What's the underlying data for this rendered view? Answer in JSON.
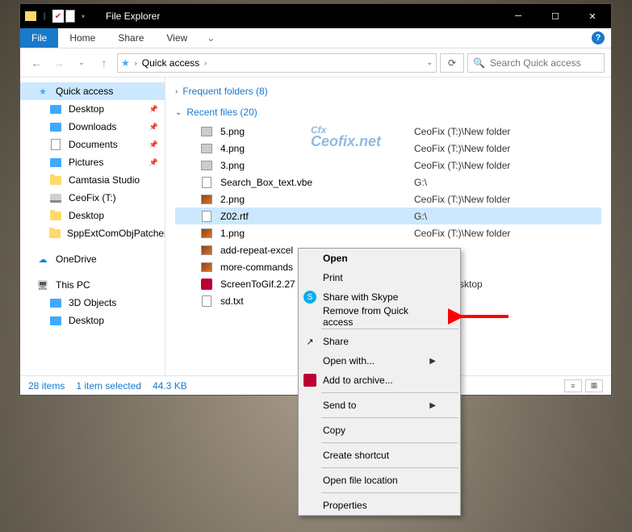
{
  "titlebar": {
    "title": "File Explorer"
  },
  "ribbon": {
    "file": "File",
    "tabs": [
      "Home",
      "Share",
      "View"
    ]
  },
  "address": {
    "location": "Quick access",
    "search_placeholder": "Search Quick access"
  },
  "sidebar": {
    "quick_access": "Quick access",
    "items": [
      {
        "label": "Desktop",
        "pinned": true,
        "ico": "blue"
      },
      {
        "label": "Downloads",
        "pinned": true,
        "ico": "blue"
      },
      {
        "label": "Documents",
        "pinned": true,
        "ico": "doc"
      },
      {
        "label": "Pictures",
        "pinned": true,
        "ico": "blue"
      },
      {
        "label": "Camtasia Studio",
        "pinned": false,
        "ico": "folder"
      },
      {
        "label": "CeoFix (T:)",
        "pinned": false,
        "ico": "disk"
      },
      {
        "label": "Desktop",
        "pinned": false,
        "ico": "folder"
      },
      {
        "label": "SppExtComObjPatcher",
        "pinned": false,
        "ico": "folder"
      }
    ],
    "onedrive": "OneDrive",
    "thispc": "This PC",
    "pc_items": [
      {
        "label": "3D Objects",
        "ico": "blue"
      },
      {
        "label": "Desktop",
        "ico": "blue"
      }
    ]
  },
  "sections": {
    "frequent": "Frequent folders (8)",
    "recent": "Recent files (20)"
  },
  "files": [
    {
      "name": "5.png",
      "path": "CeoFix (T:)\\New folder",
      "ico": "img-bw"
    },
    {
      "name": "4.png",
      "path": "CeoFix (T:)\\New folder",
      "ico": "img-bw"
    },
    {
      "name": "3.png",
      "path": "CeoFix (T:)\\New folder",
      "ico": "img-bw"
    },
    {
      "name": "Search_Box_text.vbe",
      "path": "G:\\",
      "ico": "doc"
    },
    {
      "name": "2.png",
      "path": "CeoFix (T:)\\New folder",
      "ico": "img"
    },
    {
      "name": "Z02.rtf",
      "path": "G:\\",
      "ico": "doc",
      "selected": true
    },
    {
      "name": "1.png",
      "path": "CeoFix (T:)\\New folder",
      "ico": "img"
    },
    {
      "name": "add-repeat-excel",
      "path": "",
      "ico": "img"
    },
    {
      "name": "more-commands",
      "path": "",
      "ico": "img"
    },
    {
      "name": "ScreenToGif.2.27",
      "path": "\\Ceofix\\Desktop",
      "ico": "archive"
    },
    {
      "name": "sd.txt",
      "path": "",
      "ico": "doc"
    }
  ],
  "statusbar": {
    "items": "28 items",
    "selected": "1 item selected",
    "size": "44.3 KB"
  },
  "context_menu": [
    {
      "label": "Open",
      "bold": true
    },
    {
      "label": "Print"
    },
    {
      "label": "Share with Skype",
      "icon": "skype"
    },
    {
      "label": "Remove from Quick access"
    },
    {
      "sep": true
    },
    {
      "label": "Share",
      "icon": "share"
    },
    {
      "label": "Open with...",
      "submenu": true
    },
    {
      "label": "Add to archive...",
      "icon": "archive"
    },
    {
      "sep": true
    },
    {
      "label": "Send to",
      "submenu": true
    },
    {
      "sep": true
    },
    {
      "label": "Copy"
    },
    {
      "sep": true
    },
    {
      "label": "Create shortcut"
    },
    {
      "sep": true
    },
    {
      "label": "Open file location"
    },
    {
      "sep": true
    },
    {
      "label": "Properties"
    }
  ],
  "watermark": {
    "main": "Cfx",
    "sub": "Ceofix.net"
  }
}
